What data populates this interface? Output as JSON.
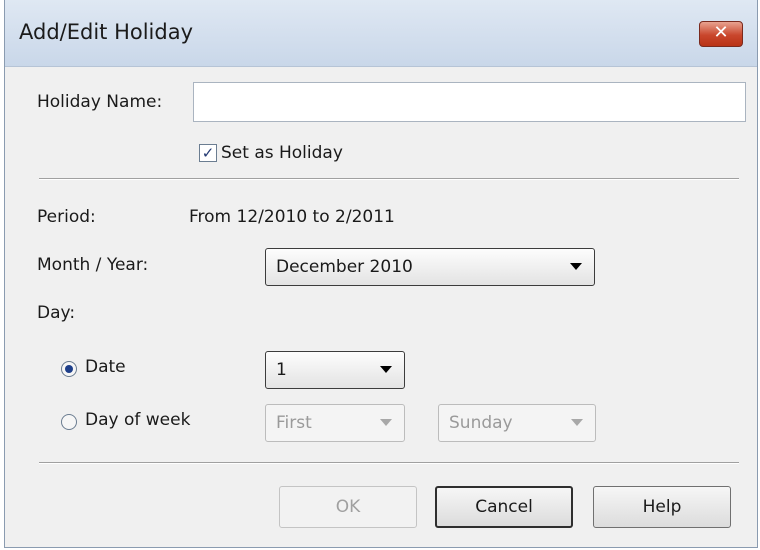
{
  "window": {
    "title": "Add/Edit Holiday",
    "close_glyph": "✕"
  },
  "form": {
    "holiday_name_label": "Holiday Name:",
    "holiday_name_value": "",
    "set_as_holiday_label": "Set as Holiday",
    "set_as_holiday_checked": true,
    "period_label": "Period:",
    "period_value": "From 12/2010 to 2/2011",
    "month_year_label": "Month / Year:",
    "month_year_value": "December 2010",
    "day_label": "Day:",
    "date_radio_label": "Date",
    "date_value": "1",
    "day_of_week_radio_label": "Day of week",
    "week_ordinal_value": "First",
    "weekday_value": "Sunday",
    "selected_day_mode": "Date"
  },
  "buttons": {
    "ok": "OK",
    "cancel": "Cancel",
    "help": "Help"
  },
  "icons": {
    "checkbox_check": "✓"
  }
}
